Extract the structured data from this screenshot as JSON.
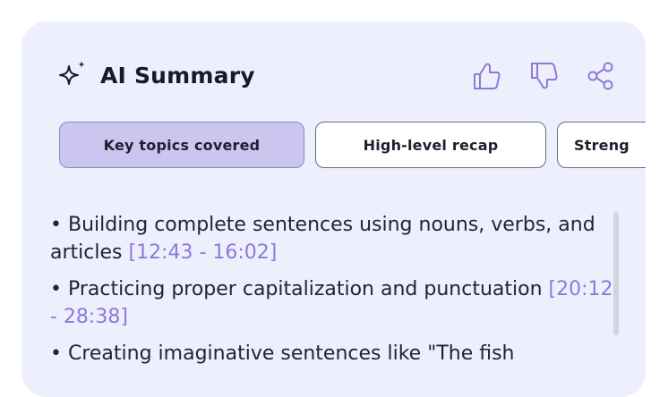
{
  "summary": {
    "title": "AI Summary",
    "icons": {
      "title_icon": "sparkle-icon",
      "like": "thumbs-up-icon",
      "dislike": "thumbs-down-icon",
      "share": "share-icon"
    },
    "chips": [
      {
        "label": "Key topics covered",
        "active": true
      },
      {
        "label": "High-level recap",
        "active": false
      },
      {
        "label": "Streng",
        "active": false
      }
    ],
    "bullets": [
      {
        "text": "• Building complete sentences using nouns, verbs, and articles",
        "time": "[12:43 - 16:02]"
      },
      {
        "text": "• Practicing proper capitalization and punctuation",
        "time": "[20:12 - 28:38]"
      },
      {
        "text": "• Creating imaginative sentences like \"The fish",
        "time": ""
      }
    ],
    "colors": {
      "card_bg": "#eeeffd",
      "active_chip_bg": "#cbc6f0",
      "timestamp": "#8c7ad6"
    }
  }
}
